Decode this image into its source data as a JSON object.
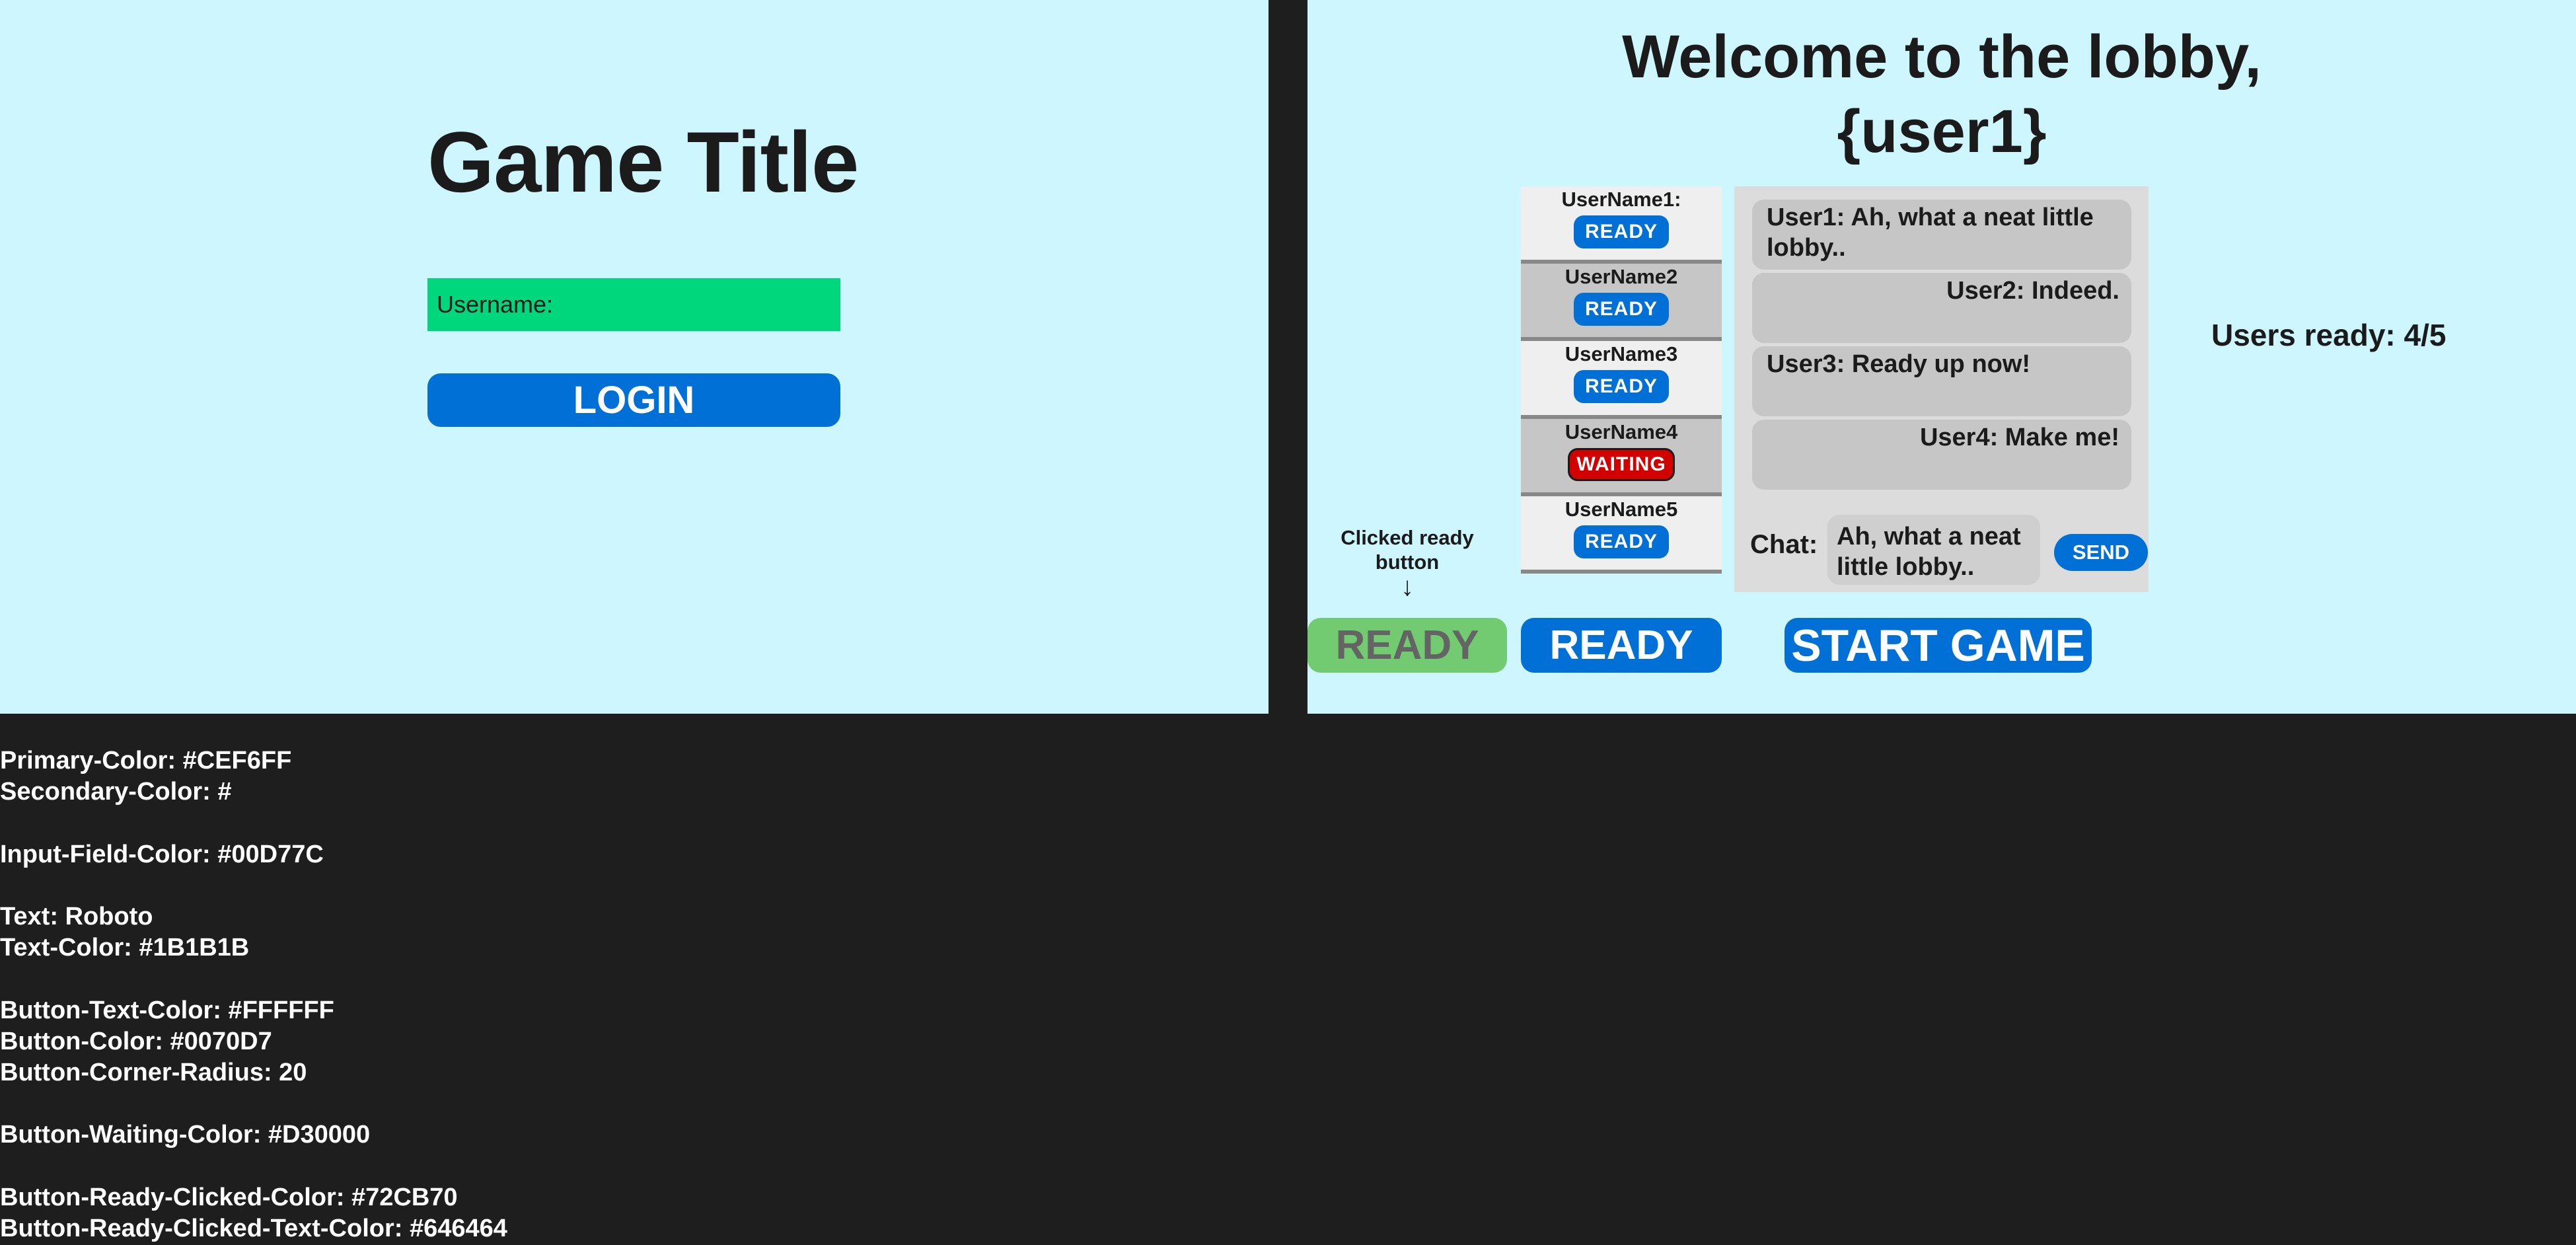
{
  "login": {
    "title": "Game Title",
    "username_placeholder": "Username:",
    "login_label": "LOGIN"
  },
  "lobby": {
    "welcome_line1": "Welcome to the lobby,",
    "welcome_line2": "{user1}",
    "users": [
      {
        "name": "UserName1:",
        "status": "READY"
      },
      {
        "name": "UserName2",
        "status": "READY"
      },
      {
        "name": "UserName3",
        "status": "READY"
      },
      {
        "name": "UserName4",
        "status": "WAITING"
      },
      {
        "name": "UserName5",
        "status": "READY"
      }
    ],
    "messages": [
      {
        "text": "User1: Ah, what a neat little lobby..",
        "align": "left"
      },
      {
        "text": "User2: Indeed.",
        "align": "right"
      },
      {
        "text": "User3: Ready up now!",
        "align": "left"
      },
      {
        "text": "User4: Make me!",
        "align": "right"
      }
    ],
    "chat_label": "Chat:",
    "chat_input_value": "Ah, what a neat little lobby..",
    "send_label": "SEND",
    "users_ready": "Users ready: 4/5",
    "clicked_note": "Clicked ready button",
    "arrow": "↓",
    "ready_clicked_label": "READY",
    "ready_label": "READY",
    "start_label": "START GAME"
  },
  "style_notes": [
    "Primary-Color: #CEF6FF",
    "Secondary-Color: #",
    "",
    "Input-Field-Color: #00D77C",
    "",
    "Text: Roboto",
    "Text-Color: #1B1B1B",
    "",
    "Button-Text-Color: #FFFFFF",
    "Button-Color: #0070D7",
    "Button-Corner-Radius: 20",
    "",
    "Button-Waiting-Color: #D30000",
    "",
    "Button-Ready-Clicked-Color: #72CB70",
    "Button-Ready-Clicked-Text-Color: #646464"
  ],
  "colors": {
    "primary": "#CEF6FF",
    "input_field": "#00D77C",
    "text": "#1B1B1B",
    "button": "#0070D7",
    "button_text": "#FFFFFF",
    "waiting": "#D30000",
    "ready_clicked": "#72CB70",
    "ready_clicked_text": "#646464"
  }
}
